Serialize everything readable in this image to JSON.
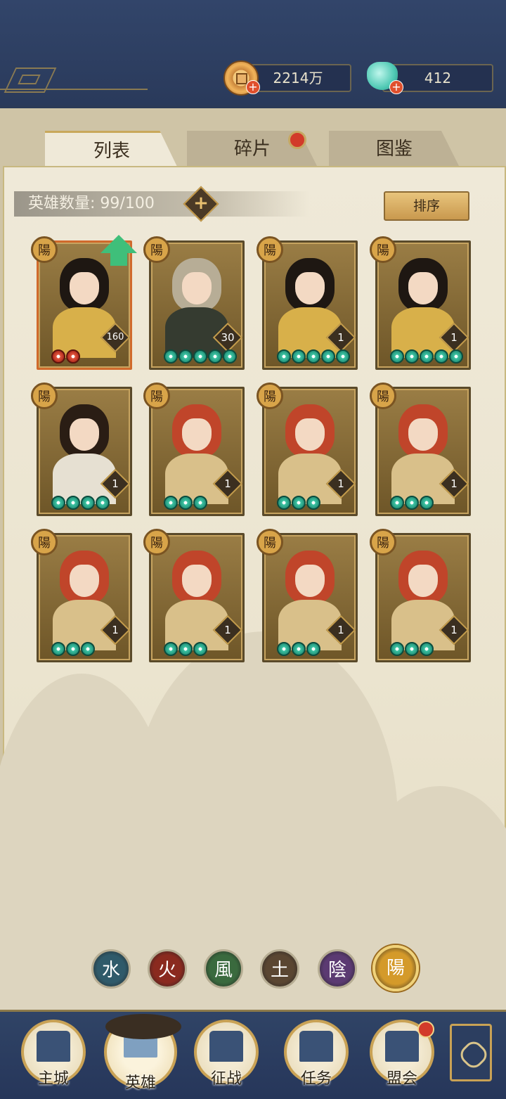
{
  "header": {
    "coins": "2214万",
    "gems": "412"
  },
  "tabs": [
    {
      "label": "列表",
      "active": true
    },
    {
      "label": "碎片",
      "active": false,
      "badge": true
    },
    {
      "label": "图鉴",
      "active": false
    }
  ],
  "hero_count": {
    "label": "英雄数量:",
    "value": "99/100"
  },
  "sort_label": "排序",
  "cards": [
    {
      "badge": "陽",
      "level": "160",
      "stars": 2,
      "star_color": "red",
      "hair": "#1e1712",
      "body": "#d8b04a",
      "highlight": true
    },
    {
      "badge": "陽",
      "level": "30",
      "stars": 5,
      "star_color": "green",
      "hair": "#b7ad96",
      "body": "#353b30"
    },
    {
      "badge": "陽",
      "level": "1",
      "stars": 5,
      "star_color": "green",
      "hair": "#1e1712",
      "body": "#d8b04a"
    },
    {
      "badge": "陽",
      "level": "1",
      "stars": 5,
      "star_color": "green",
      "hair": "#1e1712",
      "body": "#d8b04a"
    },
    {
      "badge": "陽",
      "level": "1",
      "stars": 4,
      "star_color": "green",
      "hair": "#2a1d14",
      "body": "#e6e0d2"
    },
    {
      "badge": "陽",
      "level": "1",
      "stars": 3,
      "star_color": "green",
      "hair": "#c0452a",
      "body": "#d9c08a"
    },
    {
      "badge": "陽",
      "level": "1",
      "stars": 3,
      "star_color": "green",
      "hair": "#c0452a",
      "body": "#d9c08a"
    },
    {
      "badge": "陽",
      "level": "1",
      "stars": 3,
      "star_color": "green",
      "hair": "#c0452a",
      "body": "#d9c08a"
    },
    {
      "badge": "陽",
      "level": "1",
      "stars": 3,
      "star_color": "green",
      "hair": "#c0452a",
      "body": "#d9c08a"
    },
    {
      "badge": "陽",
      "level": "1",
      "stars": 3,
      "star_color": "green",
      "hair": "#c0452a",
      "body": "#d9c08a"
    },
    {
      "badge": "陽",
      "level": "1",
      "stars": 3,
      "star_color": "green",
      "hair": "#c0452a",
      "body": "#d9c08a"
    },
    {
      "badge": "陽",
      "level": "1",
      "stars": 3,
      "star_color": "green",
      "hair": "#c0452a",
      "body": "#d9c08a"
    }
  ],
  "elements": [
    {
      "glyph": "水",
      "color": "#2f5a6a",
      "selected": false
    },
    {
      "glyph": "火",
      "color": "#8a2a1f",
      "selected": false
    },
    {
      "glyph": "風",
      "color": "#3a6a3e",
      "selected": false
    },
    {
      "glyph": "土",
      "color": "#5a4632",
      "selected": false
    },
    {
      "glyph": "陰",
      "color": "#5b3a72",
      "selected": false
    },
    {
      "glyph": "陽",
      "color": "#d49a2a",
      "selected": true
    }
  ],
  "nav": [
    {
      "label": "主城",
      "active": false
    },
    {
      "label": "英雄",
      "active": true
    },
    {
      "label": "征战",
      "active": false
    },
    {
      "label": "任务",
      "active": false
    },
    {
      "label": "盟会",
      "active": false,
      "badge": true
    }
  ]
}
